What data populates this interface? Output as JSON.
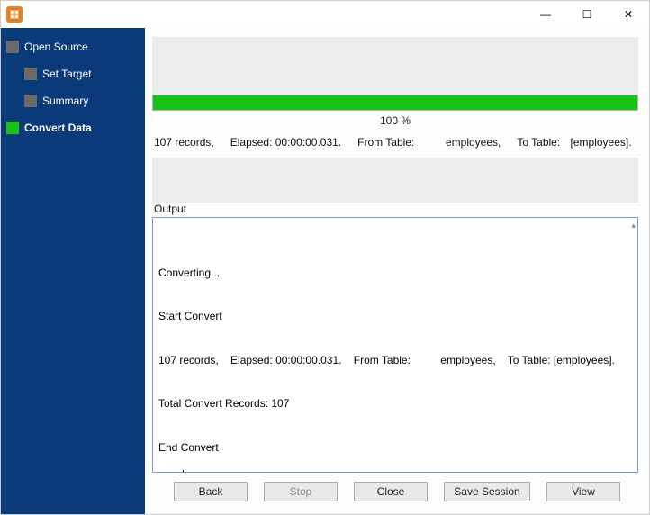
{
  "titlebar": {
    "minimize": "—",
    "maximize": "☐",
    "close": "✕"
  },
  "sidebar": {
    "items": [
      {
        "label": "Open Source",
        "active": false
      },
      {
        "label": "Set Target",
        "active": false
      },
      {
        "label": "Summary",
        "active": false
      },
      {
        "label": "Convert Data",
        "active": true
      }
    ]
  },
  "progress": {
    "percent_text": "100 %"
  },
  "status": {
    "records": "107 records,",
    "elapsed": "Elapsed: 00:00:00.031.",
    "from_label": "From Table:",
    "from_value": "employees,",
    "to_label": "To Table:",
    "to_value": "[employees]."
  },
  "output": {
    "label": "Output",
    "lines": [
      "Converting...",
      "Start Convert",
      "107 records,    Elapsed: 00:00:00.031.    From Table:          employees,    To Table: [employees].",
      "Total Convert Records: 107",
      "End Convert"
    ]
  },
  "buttons": {
    "back": "Back",
    "stop": "Stop",
    "close": "Close",
    "save": "Save Session",
    "view": "View"
  }
}
